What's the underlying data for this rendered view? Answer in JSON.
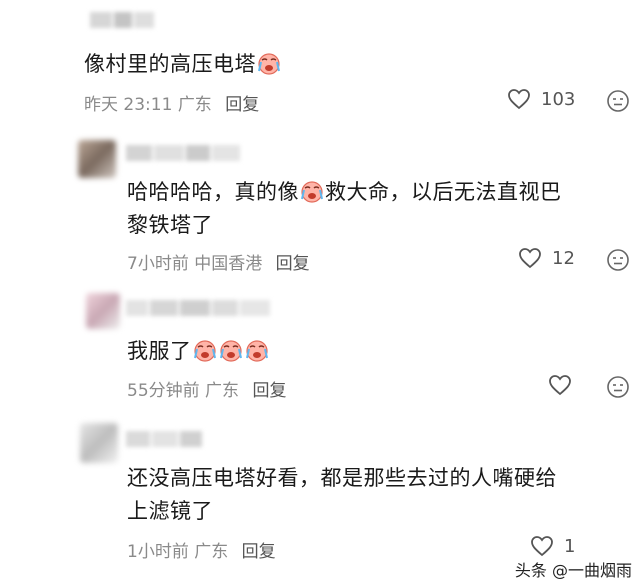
{
  "comments": [
    {
      "text": "像村里的高压电塔",
      "emoji_count": 1,
      "time": "昨天 23:11",
      "location": "广东",
      "reply": "回复",
      "likes": "103"
    },
    {
      "text_part1": "哈哈哈哈，真的像",
      "text_part2": "救大命，以后无法直视巴",
      "text_line2": "黎铁塔了",
      "time": "7小时前",
      "location": "中国香港",
      "reply": "回复",
      "likes": "12"
    },
    {
      "text": "我服了",
      "emoji_count": 3,
      "time": "55分钟前",
      "location": "广东",
      "reply": "回复",
      "likes": ""
    },
    {
      "text_line1": "还没高压电塔好看，都是那些去过的人嘴硬给",
      "text_line2": "上滤镜了",
      "time": "1小时前",
      "location": "广东",
      "reply": "回复",
      "likes": "1"
    }
  ],
  "watermark": "头条 @一曲烟雨",
  "icons": {
    "like": "heart-icon",
    "react": "emoji-face-icon",
    "crying_emoji": "crying-emoji-icon"
  },
  "colors": {
    "meta": "#8a8a8a",
    "text": "#1a1a1a"
  }
}
